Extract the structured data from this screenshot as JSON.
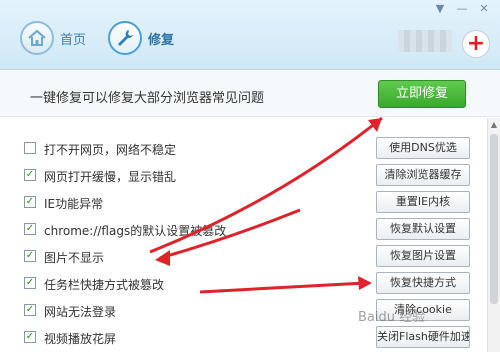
{
  "header": {
    "tabs": [
      {
        "label": "首页",
        "icon": "home-icon"
      },
      {
        "label": "修复",
        "icon": "wrench-icon"
      }
    ],
    "window_controls": [
      "▼",
      "—",
      "✕"
    ],
    "plus_icon": "+"
  },
  "banner": {
    "text": "一键修复可以修复大部分浏览器常见问题",
    "button": "立即修复",
    "button_color": "#3aa82b"
  },
  "rows": [
    {
      "label": "打不开网页，网络不稳定",
      "checked": false,
      "button": "使用DNS优选"
    },
    {
      "label": "网页打开缓慢，显示错乱",
      "checked": true,
      "button": "清除浏览器缓存"
    },
    {
      "label": "IE功能异常",
      "checked": true,
      "button": "重置IE内核"
    },
    {
      "label": "chrome://flags的默认设置被篡改",
      "checked": true,
      "button": "恢复默认设置"
    },
    {
      "label": "图片不显示",
      "checked": true,
      "button": "恢复图片设置"
    },
    {
      "label": "任务栏快捷方式被篡改",
      "checked": true,
      "button": "恢复快捷方式"
    },
    {
      "label": "网站无法登录",
      "checked": true,
      "button": "清除cookie"
    },
    {
      "label": "视频播放花屏",
      "checked": true,
      "button": "关闭Flash硬件加速"
    }
  ],
  "watermark": "Baidu 经验",
  "annotation_color": "#e0222b"
}
